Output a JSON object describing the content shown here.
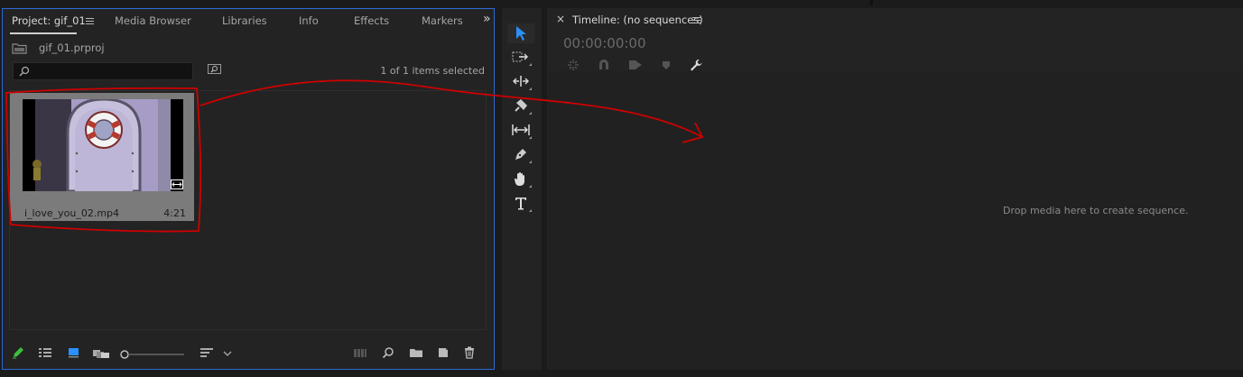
{
  "project_panel": {
    "tabs": [
      {
        "label": "Project: gif_01"
      },
      {
        "label": "Media Browser"
      },
      {
        "label": "Libraries"
      },
      {
        "label": "Info"
      },
      {
        "label": "Effects"
      },
      {
        "label": "Markers"
      }
    ],
    "overflow_label": "»",
    "project_file": "gif_01.prproj",
    "selection_status": "1 of 1 items selected",
    "clip": {
      "name": "i_love_you_02.mp4",
      "duration": "4:21"
    }
  },
  "timeline_panel": {
    "close_label": "×",
    "title": "Timeline: (no sequences)",
    "timecode": "00:00:00:00",
    "drop_hint": "Drop media here to create sequence."
  },
  "colors": {
    "accent_blue": "#2d6ad6",
    "annotation_red": "#d00000",
    "panel_bg": "#232323",
    "active_tool": "#2b8fff"
  },
  "icons": {
    "tools": [
      "selection-tool-icon",
      "track-select-tool-icon",
      "ripple-edit-tool-icon",
      "razor-tool-icon",
      "slip-tool-icon",
      "pen-tool-icon",
      "hand-tool-icon",
      "type-tool-icon"
    ],
    "bottom": [
      "pencil-icon",
      "list-view-icon",
      "icon-view-icon",
      "freeform-view-icon",
      "zoom-slider",
      "sort-icon",
      "automate-icon",
      "find-icon",
      "new-bin-icon",
      "new-item-icon",
      "trash-icon"
    ]
  }
}
